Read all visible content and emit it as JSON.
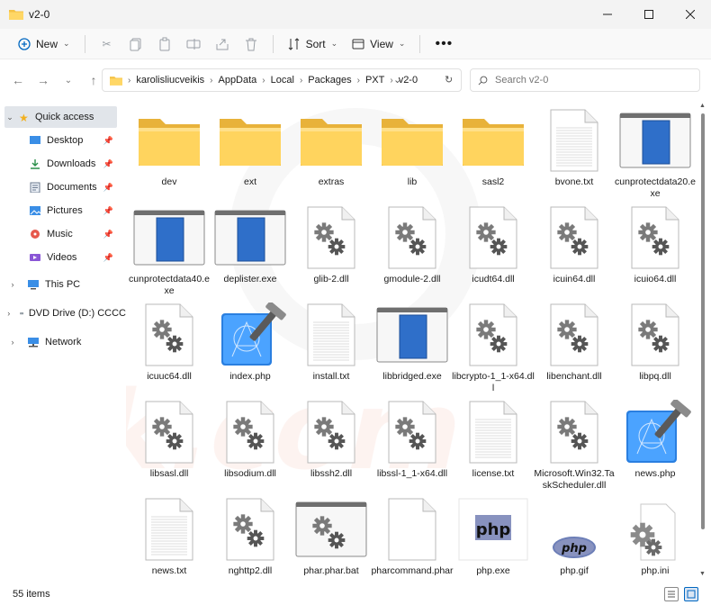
{
  "window": {
    "title": "v2-0"
  },
  "toolbar": {
    "new_label": "New",
    "sort_label": "Sort",
    "view_label": "View"
  },
  "address": {
    "crumbs": [
      "karolisliucveikis",
      "AppData",
      "Local",
      "Packages",
      "PXT",
      "v2-0"
    ]
  },
  "search": {
    "placeholder": "Search v2-0"
  },
  "sidebar": {
    "quick_access": "Quick access",
    "items": [
      {
        "label": "Desktop",
        "icon": "desktop-icon"
      },
      {
        "label": "Downloads",
        "icon": "downloads-icon"
      },
      {
        "label": "Documents",
        "icon": "documents-icon"
      },
      {
        "label": "Pictures",
        "icon": "pictures-icon"
      },
      {
        "label": "Music",
        "icon": "music-icon"
      },
      {
        "label": "Videos",
        "icon": "videos-icon"
      }
    ],
    "this_pc": "This PC",
    "dvd": "DVD Drive (D:) CCCC",
    "network": "Network"
  },
  "files": [
    {
      "name": "dev",
      "type": "folder"
    },
    {
      "name": "ext",
      "type": "folder"
    },
    {
      "name": "extras",
      "type": "folder"
    },
    {
      "name": "lib",
      "type": "folder"
    },
    {
      "name": "sasl2",
      "type": "folder"
    },
    {
      "name": "bvone.txt",
      "type": "txt"
    },
    {
      "name": "cunprotectdata20.exe",
      "type": "exe"
    },
    {
      "name": "cunprotectdata40.exe",
      "type": "exe"
    },
    {
      "name": "deplister.exe",
      "type": "exe"
    },
    {
      "name": "glib-2.dll",
      "type": "dll"
    },
    {
      "name": "gmodule-2.dll",
      "type": "dll"
    },
    {
      "name": "icudt64.dll",
      "type": "dll"
    },
    {
      "name": "icuin64.dll",
      "type": "dll"
    },
    {
      "name": "icuio64.dll",
      "type": "dll"
    },
    {
      "name": "icuuc64.dll",
      "type": "dll"
    },
    {
      "name": "index.php",
      "type": "xcode"
    },
    {
      "name": "install.txt",
      "type": "txt"
    },
    {
      "name": "libbridged.exe",
      "type": "exe"
    },
    {
      "name": "libcrypto-1_1-x64.dll",
      "type": "dll"
    },
    {
      "name": "libenchant.dll",
      "type": "dll"
    },
    {
      "name": "libpq.dll",
      "type": "dll"
    },
    {
      "name": "libsasl.dll",
      "type": "dll"
    },
    {
      "name": "libsodium.dll",
      "type": "dll"
    },
    {
      "name": "libssh2.dll",
      "type": "dll"
    },
    {
      "name": "libssl-1_1-x64.dll",
      "type": "dll"
    },
    {
      "name": "license.txt",
      "type": "txt"
    },
    {
      "name": "Microsoft.Win32.TaskScheduler.dll",
      "type": "dll"
    },
    {
      "name": "news.php",
      "type": "xcode"
    },
    {
      "name": "news.txt",
      "type": "txt"
    },
    {
      "name": "nghttp2.dll",
      "type": "dll"
    },
    {
      "name": "phar.phar.bat",
      "type": "bat"
    },
    {
      "name": "pharcommand.phar",
      "type": "blank"
    },
    {
      "name": "php.exe",
      "type": "phpexe"
    },
    {
      "name": "php.gif",
      "type": "phpgif"
    },
    {
      "name": "php.ini",
      "type": "ini"
    }
  ],
  "icon_texts": {
    "php_exe": "php",
    "php_gif": "php"
  },
  "status": {
    "count": "55 items"
  }
}
